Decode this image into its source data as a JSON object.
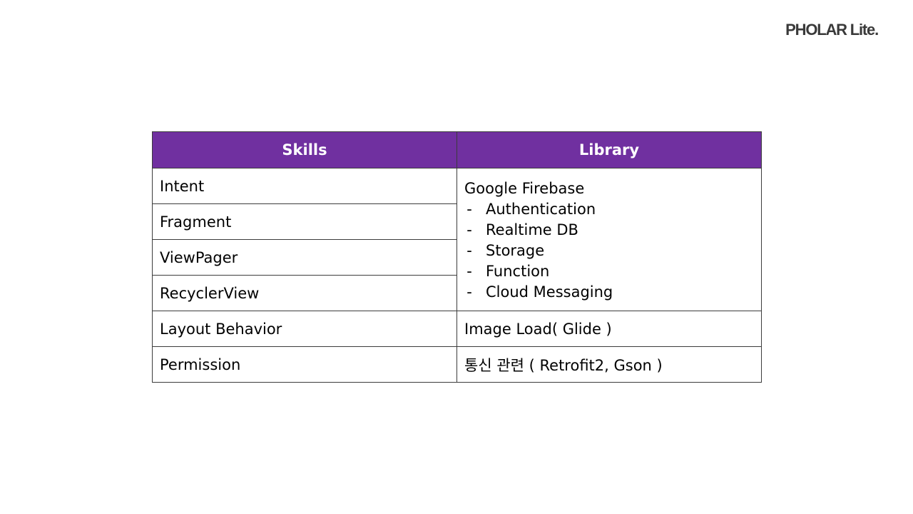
{
  "brand": "PHOLAR Lite.",
  "colors": {
    "header_bg": "#7030a0",
    "header_text": "#ffffff",
    "border": "#3c3c3c"
  },
  "table": {
    "headers": {
      "skills": "Skills",
      "library": "Library"
    },
    "skills": [
      "Intent",
      "Fragment",
      "ViewPager",
      "RecyclerView",
      "Layout Behavior",
      "Permission"
    ],
    "library": {
      "firebase": {
        "title": "Google Firebase",
        "bullet": "-",
        "items": [
          "Authentication",
          "Realtime DB",
          "Storage",
          "Function",
          "Cloud Messaging"
        ]
      },
      "image_load": "Image Load( Glide )",
      "network": "통신 관련 ( Retrofit2, Gson )"
    }
  }
}
